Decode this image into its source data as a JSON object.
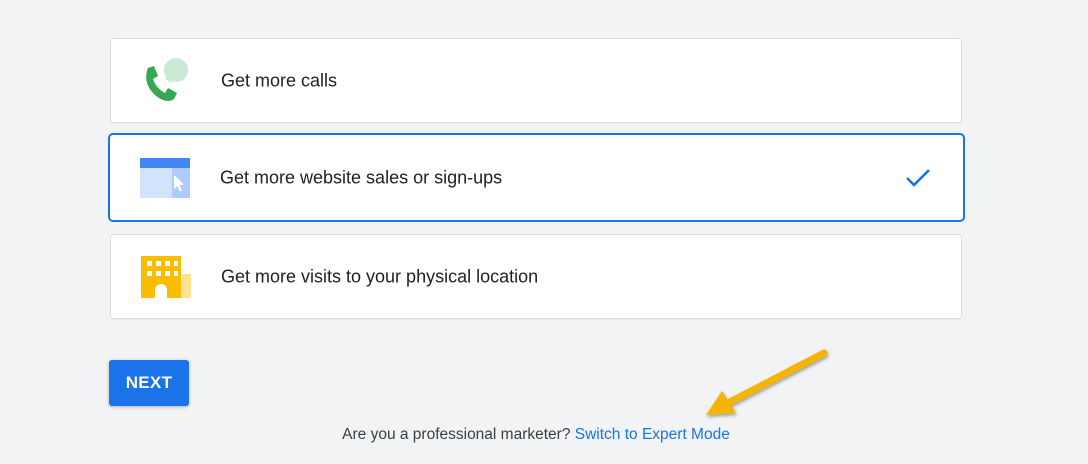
{
  "goals": [
    {
      "label": "Get more calls",
      "icon": "phone-call-icon",
      "selected": false
    },
    {
      "label": "Get more website sales or sign-ups",
      "icon": "website-cursor-icon",
      "selected": true
    },
    {
      "label": "Get more visits to your physical location",
      "icon": "storefront-icon",
      "selected": false
    }
  ],
  "next_label": "NEXT",
  "footer": {
    "prompt": "Are you a professional marketer?",
    "link": "Switch to Expert Mode"
  },
  "colors": {
    "accent": "#1a73e8",
    "background": "#f1f3f4",
    "annotation_arrow": "#f4b400"
  }
}
